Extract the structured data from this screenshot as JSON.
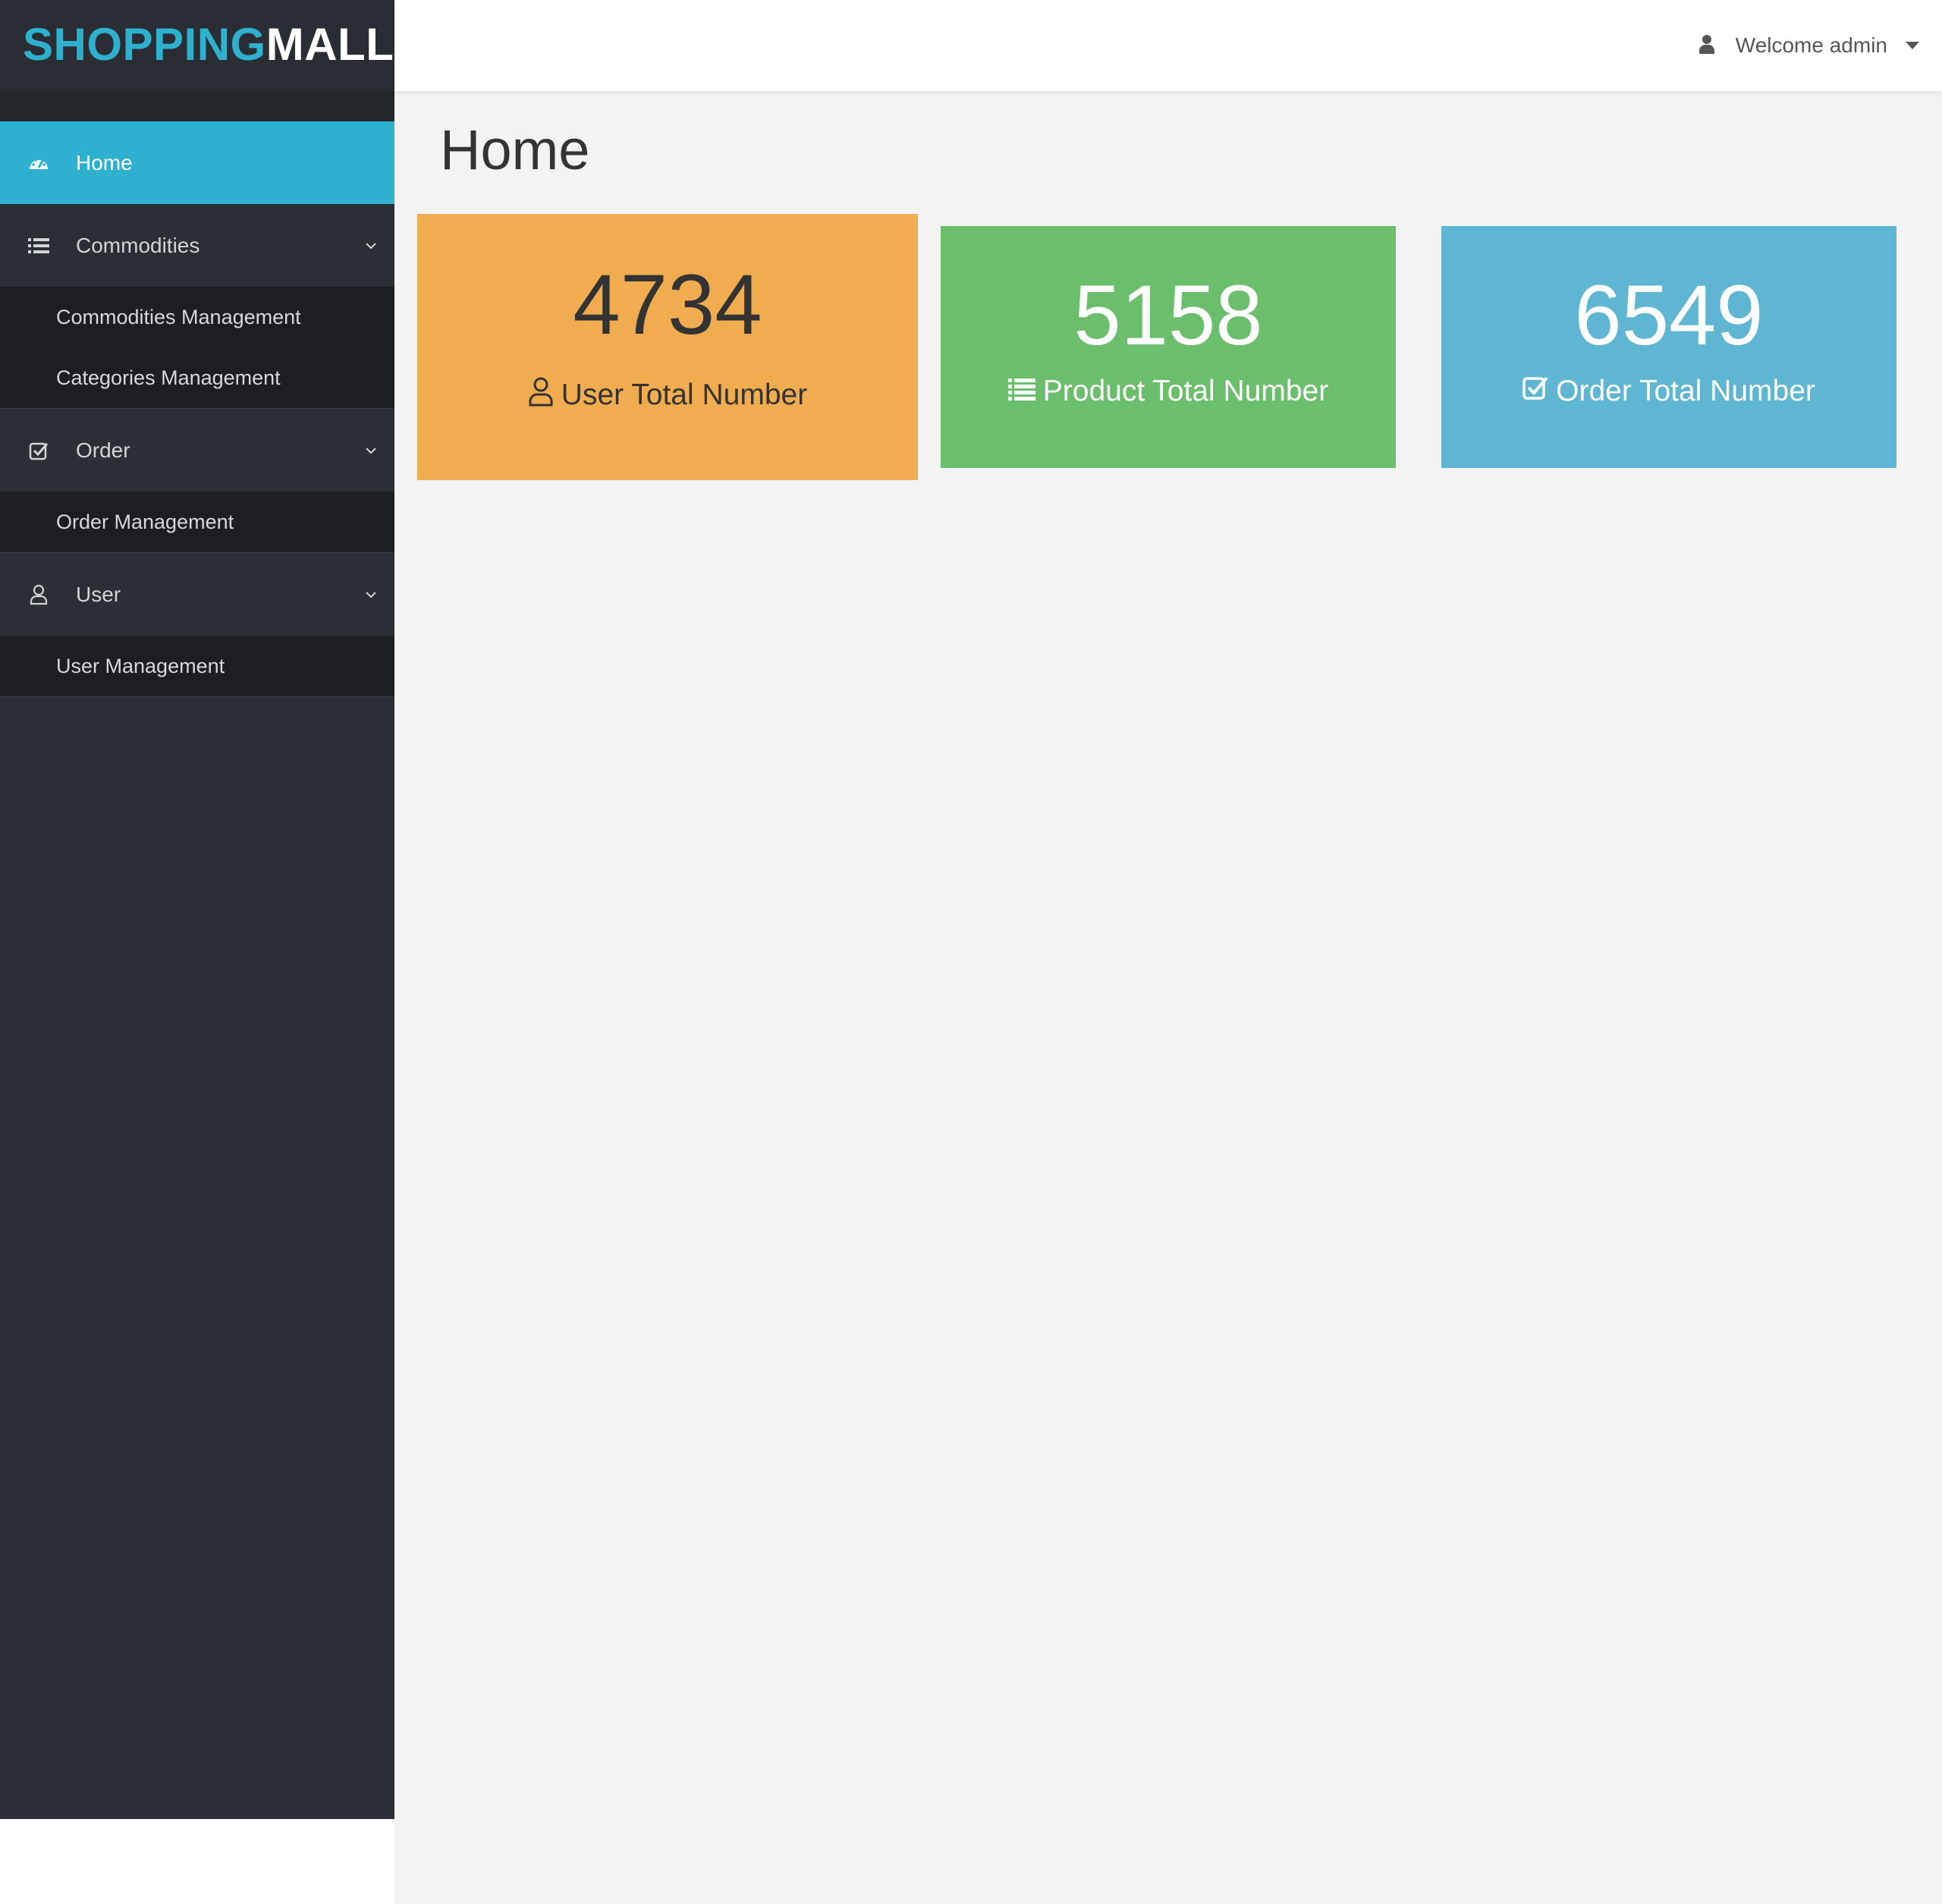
{
  "brand": {
    "part1": "SHOPPING",
    "part2": "MALL"
  },
  "header": {
    "welcome": "Welcome admin"
  },
  "sidebar": {
    "items": [
      {
        "label": "Home",
        "icon": "dashboard-icon",
        "active": true
      },
      {
        "label": "Commodities",
        "icon": "list-icon",
        "children": [
          "Commodities Management",
          "Categories Management"
        ]
      },
      {
        "label": "Order",
        "icon": "check-square-icon",
        "children": [
          "Order Management"
        ]
      },
      {
        "label": "User",
        "icon": "user-icon",
        "children": [
          "User Management"
        ]
      }
    ]
  },
  "main": {
    "title": "Home",
    "cards": [
      {
        "value": "4734",
        "caption": "User Total Number",
        "color": "#f0ac4e",
        "icon": "user-icon"
      },
      {
        "value": "5158",
        "caption": "Product Total Number",
        "color": "#6bbe6b",
        "icon": "list-icon"
      },
      {
        "value": "6549",
        "caption": "Order Total Number",
        "color": "#5eb6d2",
        "icon": "check-square-icon"
      }
    ]
  },
  "colors": {
    "accent": "#2eb0cf",
    "sidebar": "#2b2e34",
    "subnav": "#1c1e21"
  }
}
